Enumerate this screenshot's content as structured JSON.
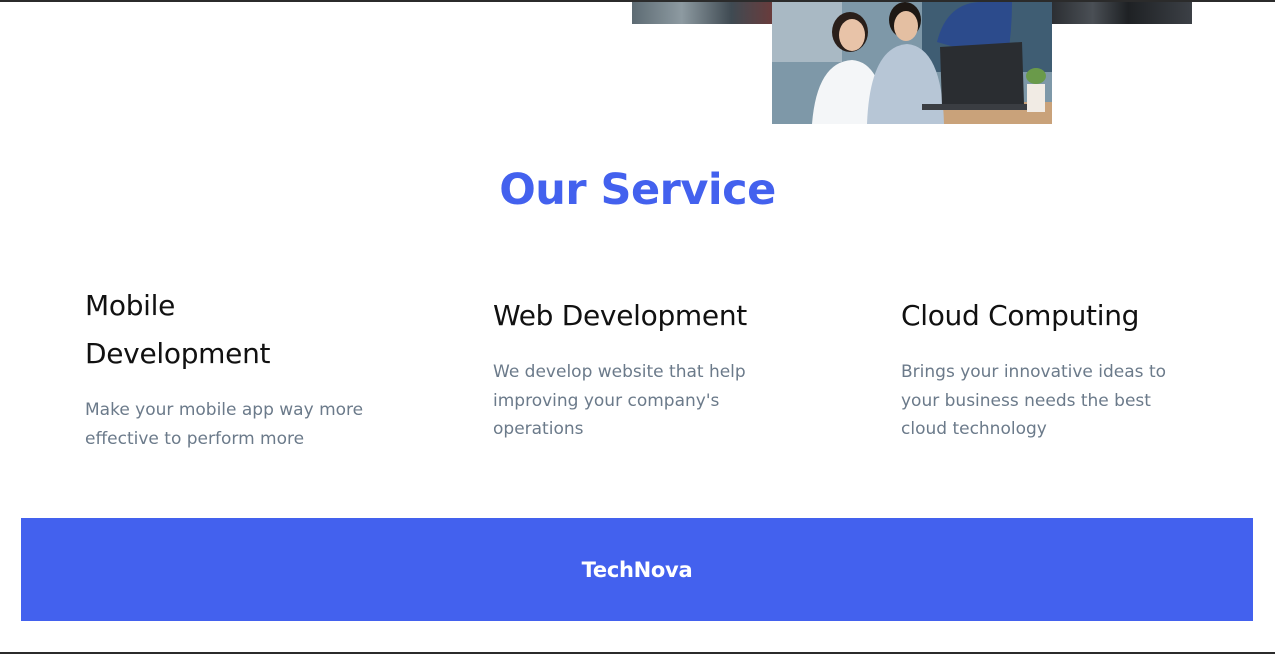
{
  "services_section": {
    "title": "Our Service",
    "items": [
      {
        "heading": "Mobile Development",
        "description": "Make your mobile app way more effective to perform more"
      },
      {
        "heading": "Web Development",
        "description": "We develop website that help improving your company's operations"
      },
      {
        "heading": "Cloud Computing",
        "description": "Brings your innovative ideas to your business needs the best cloud technology"
      }
    ]
  },
  "footer": {
    "brand": "TechNova"
  },
  "colors": {
    "accent": "#4361ee",
    "heading_text": "#111111",
    "body_text": "#6b7a8a",
    "footer_text": "#ffffff"
  }
}
